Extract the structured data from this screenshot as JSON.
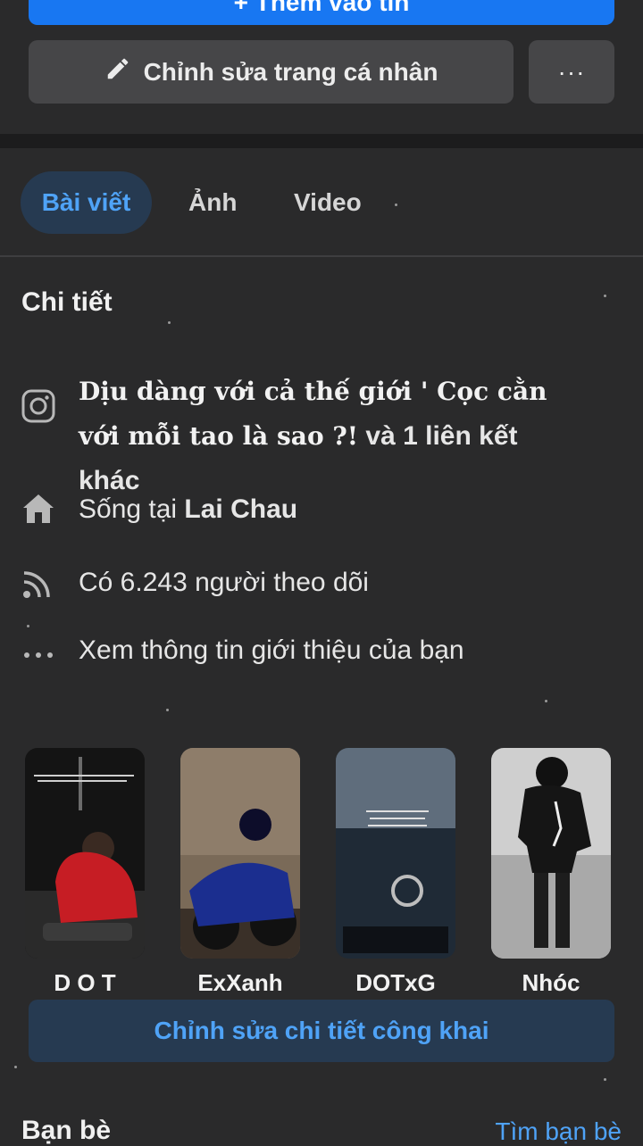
{
  "top_button": {
    "label": "+ Thêm vào tin"
  },
  "edit_profile": {
    "label": "Chỉnh sửa trang cá nhân",
    "more_label": "···"
  },
  "tabs": [
    {
      "label": "Bài viết",
      "active": true
    },
    {
      "label": "Ảnh",
      "active": false
    },
    {
      "label": "Video",
      "active": false
    }
  ],
  "details": {
    "title": "Chi tiết",
    "instagram": {
      "link_text": "Dịu dàng với cả thế giới ' Cọc cằn với mỗi tao là sao ?!",
      "suffix": " và 1 liên kết khác",
      "icon": "instagram-icon"
    },
    "lives_in": {
      "prefix": "Sống tại ",
      "place": "Lai Chau",
      "icon": "home-icon"
    },
    "followers": {
      "text": "Có 6.243 người theo dõi",
      "icon": "rss-icon"
    },
    "about": {
      "text": "Xem thông tin giới thiệu của bạn",
      "icon": "more-dots-icon"
    }
  },
  "featured": [
    {
      "label": "D O T"
    },
    {
      "label": "ExXanh"
    },
    {
      "label": "DOTxG"
    },
    {
      "label": "Nhóc"
    }
  ],
  "edit_public": {
    "label": "Chỉnh sửa chi tiết công khai"
  },
  "friends": {
    "title": "Bạn bè",
    "find_link": "Tìm bạn bè"
  },
  "colors": {
    "accent": "#1877f2",
    "link": "#4fa3f7",
    "background": "#2a2a2b",
    "button": "#464648"
  }
}
